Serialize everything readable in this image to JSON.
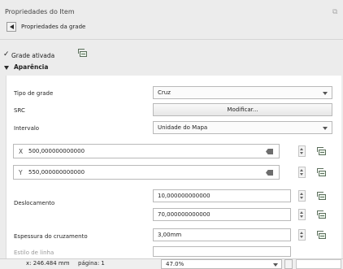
{
  "window": {
    "title": "Propriedades do Item"
  },
  "header": {
    "subtitle": "Propriedades da grade"
  },
  "grid_enabled": {
    "checked": true,
    "label": "Grade ativada"
  },
  "section": {
    "title": "Aparência"
  },
  "fields": {
    "grid_type": {
      "label": "Tipo de grade",
      "value": "Cruz"
    },
    "src": {
      "label": "SRC",
      "button": "Modificar..."
    },
    "interval": {
      "label": "Intervalo",
      "value": "Unidade do Mapa"
    },
    "x": {
      "axis": "X",
      "value": "500,000000000000"
    },
    "y": {
      "axis": "Y",
      "value": "550,000000000000"
    },
    "offset": {
      "label": "Deslocamento",
      "value_x": "10,000000000000",
      "value_y": "70,000000000000"
    },
    "cross_width": {
      "label": "Espessura do cruzamento",
      "value": "3,00mm"
    },
    "cut_label": "Estilo de linha"
  },
  "statusbar": {
    "coord": "x: 246.484 mm",
    "page": "página: 1",
    "zoom": "47.0%"
  }
}
